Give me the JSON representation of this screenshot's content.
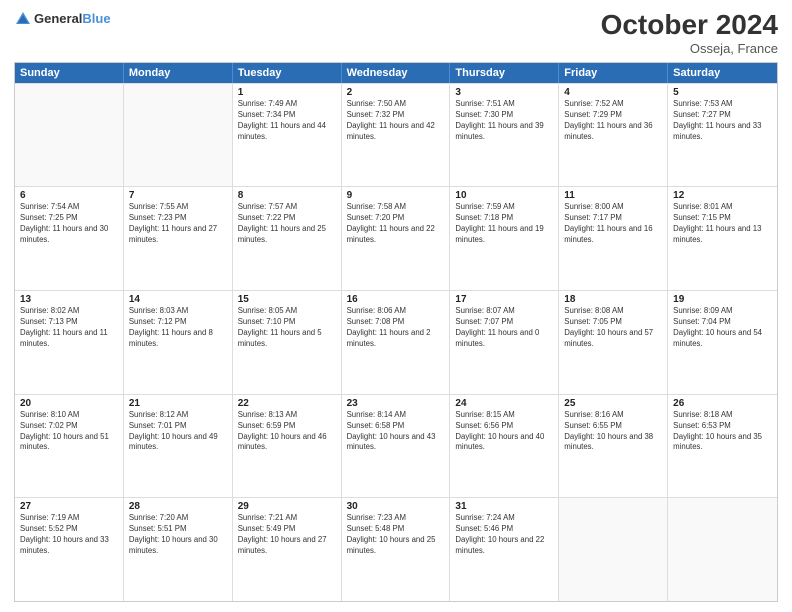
{
  "logo": {
    "general": "General",
    "blue": "Blue"
  },
  "header": {
    "month": "October 2024",
    "location": "Osseja, France"
  },
  "weekdays": [
    "Sunday",
    "Monday",
    "Tuesday",
    "Wednesday",
    "Thursday",
    "Friday",
    "Saturday"
  ],
  "rows": [
    [
      {
        "day": "",
        "sunrise": "",
        "sunset": "",
        "daylight": "",
        "empty": true
      },
      {
        "day": "",
        "sunrise": "",
        "sunset": "",
        "daylight": "",
        "empty": true
      },
      {
        "day": "1",
        "sunrise": "Sunrise: 7:49 AM",
        "sunset": "Sunset: 7:34 PM",
        "daylight": "Daylight: 11 hours and 44 minutes."
      },
      {
        "day": "2",
        "sunrise": "Sunrise: 7:50 AM",
        "sunset": "Sunset: 7:32 PM",
        "daylight": "Daylight: 11 hours and 42 minutes."
      },
      {
        "day": "3",
        "sunrise": "Sunrise: 7:51 AM",
        "sunset": "Sunset: 7:30 PM",
        "daylight": "Daylight: 11 hours and 39 minutes."
      },
      {
        "day": "4",
        "sunrise": "Sunrise: 7:52 AM",
        "sunset": "Sunset: 7:29 PM",
        "daylight": "Daylight: 11 hours and 36 minutes."
      },
      {
        "day": "5",
        "sunrise": "Sunrise: 7:53 AM",
        "sunset": "Sunset: 7:27 PM",
        "daylight": "Daylight: 11 hours and 33 minutes."
      }
    ],
    [
      {
        "day": "6",
        "sunrise": "Sunrise: 7:54 AM",
        "sunset": "Sunset: 7:25 PM",
        "daylight": "Daylight: 11 hours and 30 minutes."
      },
      {
        "day": "7",
        "sunrise": "Sunrise: 7:55 AM",
        "sunset": "Sunset: 7:23 PM",
        "daylight": "Daylight: 11 hours and 27 minutes."
      },
      {
        "day": "8",
        "sunrise": "Sunrise: 7:57 AM",
        "sunset": "Sunset: 7:22 PM",
        "daylight": "Daylight: 11 hours and 25 minutes."
      },
      {
        "day": "9",
        "sunrise": "Sunrise: 7:58 AM",
        "sunset": "Sunset: 7:20 PM",
        "daylight": "Daylight: 11 hours and 22 minutes."
      },
      {
        "day": "10",
        "sunrise": "Sunrise: 7:59 AM",
        "sunset": "Sunset: 7:18 PM",
        "daylight": "Daylight: 11 hours and 19 minutes."
      },
      {
        "day": "11",
        "sunrise": "Sunrise: 8:00 AM",
        "sunset": "Sunset: 7:17 PM",
        "daylight": "Daylight: 11 hours and 16 minutes."
      },
      {
        "day": "12",
        "sunrise": "Sunrise: 8:01 AM",
        "sunset": "Sunset: 7:15 PM",
        "daylight": "Daylight: 11 hours and 13 minutes."
      }
    ],
    [
      {
        "day": "13",
        "sunrise": "Sunrise: 8:02 AM",
        "sunset": "Sunset: 7:13 PM",
        "daylight": "Daylight: 11 hours and 11 minutes."
      },
      {
        "day": "14",
        "sunrise": "Sunrise: 8:03 AM",
        "sunset": "Sunset: 7:12 PM",
        "daylight": "Daylight: 11 hours and 8 minutes."
      },
      {
        "day": "15",
        "sunrise": "Sunrise: 8:05 AM",
        "sunset": "Sunset: 7:10 PM",
        "daylight": "Daylight: 11 hours and 5 minutes."
      },
      {
        "day": "16",
        "sunrise": "Sunrise: 8:06 AM",
        "sunset": "Sunset: 7:08 PM",
        "daylight": "Daylight: 11 hours and 2 minutes."
      },
      {
        "day": "17",
        "sunrise": "Sunrise: 8:07 AM",
        "sunset": "Sunset: 7:07 PM",
        "daylight": "Daylight: 11 hours and 0 minutes."
      },
      {
        "day": "18",
        "sunrise": "Sunrise: 8:08 AM",
        "sunset": "Sunset: 7:05 PM",
        "daylight": "Daylight: 10 hours and 57 minutes."
      },
      {
        "day": "19",
        "sunrise": "Sunrise: 8:09 AM",
        "sunset": "Sunset: 7:04 PM",
        "daylight": "Daylight: 10 hours and 54 minutes."
      }
    ],
    [
      {
        "day": "20",
        "sunrise": "Sunrise: 8:10 AM",
        "sunset": "Sunset: 7:02 PM",
        "daylight": "Daylight: 10 hours and 51 minutes."
      },
      {
        "day": "21",
        "sunrise": "Sunrise: 8:12 AM",
        "sunset": "Sunset: 7:01 PM",
        "daylight": "Daylight: 10 hours and 49 minutes."
      },
      {
        "day": "22",
        "sunrise": "Sunrise: 8:13 AM",
        "sunset": "Sunset: 6:59 PM",
        "daylight": "Daylight: 10 hours and 46 minutes."
      },
      {
        "day": "23",
        "sunrise": "Sunrise: 8:14 AM",
        "sunset": "Sunset: 6:58 PM",
        "daylight": "Daylight: 10 hours and 43 minutes."
      },
      {
        "day": "24",
        "sunrise": "Sunrise: 8:15 AM",
        "sunset": "Sunset: 6:56 PM",
        "daylight": "Daylight: 10 hours and 40 minutes."
      },
      {
        "day": "25",
        "sunrise": "Sunrise: 8:16 AM",
        "sunset": "Sunset: 6:55 PM",
        "daylight": "Daylight: 10 hours and 38 minutes."
      },
      {
        "day": "26",
        "sunrise": "Sunrise: 8:18 AM",
        "sunset": "Sunset: 6:53 PM",
        "daylight": "Daylight: 10 hours and 35 minutes."
      }
    ],
    [
      {
        "day": "27",
        "sunrise": "Sunrise: 7:19 AM",
        "sunset": "Sunset: 5:52 PM",
        "daylight": "Daylight: 10 hours and 33 minutes."
      },
      {
        "day": "28",
        "sunrise": "Sunrise: 7:20 AM",
        "sunset": "Sunset: 5:51 PM",
        "daylight": "Daylight: 10 hours and 30 minutes."
      },
      {
        "day": "29",
        "sunrise": "Sunrise: 7:21 AM",
        "sunset": "Sunset: 5:49 PM",
        "daylight": "Daylight: 10 hours and 27 minutes."
      },
      {
        "day": "30",
        "sunrise": "Sunrise: 7:23 AM",
        "sunset": "Sunset: 5:48 PM",
        "daylight": "Daylight: 10 hours and 25 minutes."
      },
      {
        "day": "31",
        "sunrise": "Sunrise: 7:24 AM",
        "sunset": "Sunset: 5:46 PM",
        "daylight": "Daylight: 10 hours and 22 minutes."
      },
      {
        "day": "",
        "sunrise": "",
        "sunset": "",
        "daylight": "",
        "empty": true
      },
      {
        "day": "",
        "sunrise": "",
        "sunset": "",
        "daylight": "",
        "empty": true
      }
    ]
  ]
}
